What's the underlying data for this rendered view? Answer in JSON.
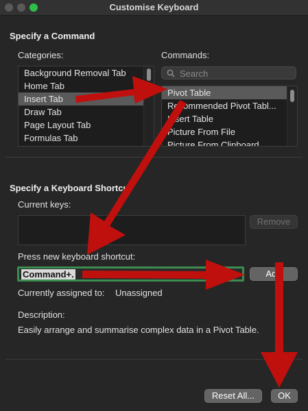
{
  "window": {
    "title": "Customise Keyboard"
  },
  "specify_command": {
    "title": "Specify a Command",
    "categories_label": "Categories:",
    "categories": [
      "Background Removal Tab",
      "Home Tab",
      "Insert Tab",
      "Draw Tab",
      "Page Layout Tab",
      "Formulas Tab"
    ],
    "selected_category": "Insert Tab",
    "commands_label": "Commands:",
    "search_placeholder": "Search",
    "commands": [
      "Pivot Table",
      "Recommended Pivot Tabl...",
      "Insert Table",
      "Picture From File",
      "Picture From Clipboard"
    ],
    "selected_command": "Pivot Table"
  },
  "shortcut": {
    "title": "Specify a Keyboard Shortcut",
    "current_keys_label": "Current keys:",
    "remove_label": "Remove",
    "new_shortcut_label": "Press new keyboard shortcut:",
    "new_shortcut_value": "Command+.",
    "add_label": "Add",
    "assigned_label": "Currently assigned to:",
    "assigned_value": "Unassigned",
    "description_label": "Description:",
    "description_text": "Easily arrange and summarise complex data in a Pivot Table."
  },
  "footer": {
    "reset_label": "Reset All...",
    "ok_label": "OK"
  },
  "colors": {
    "arrow": "#c0100e",
    "focus_ring": "#3d8c50",
    "window_bg": "#262626"
  }
}
